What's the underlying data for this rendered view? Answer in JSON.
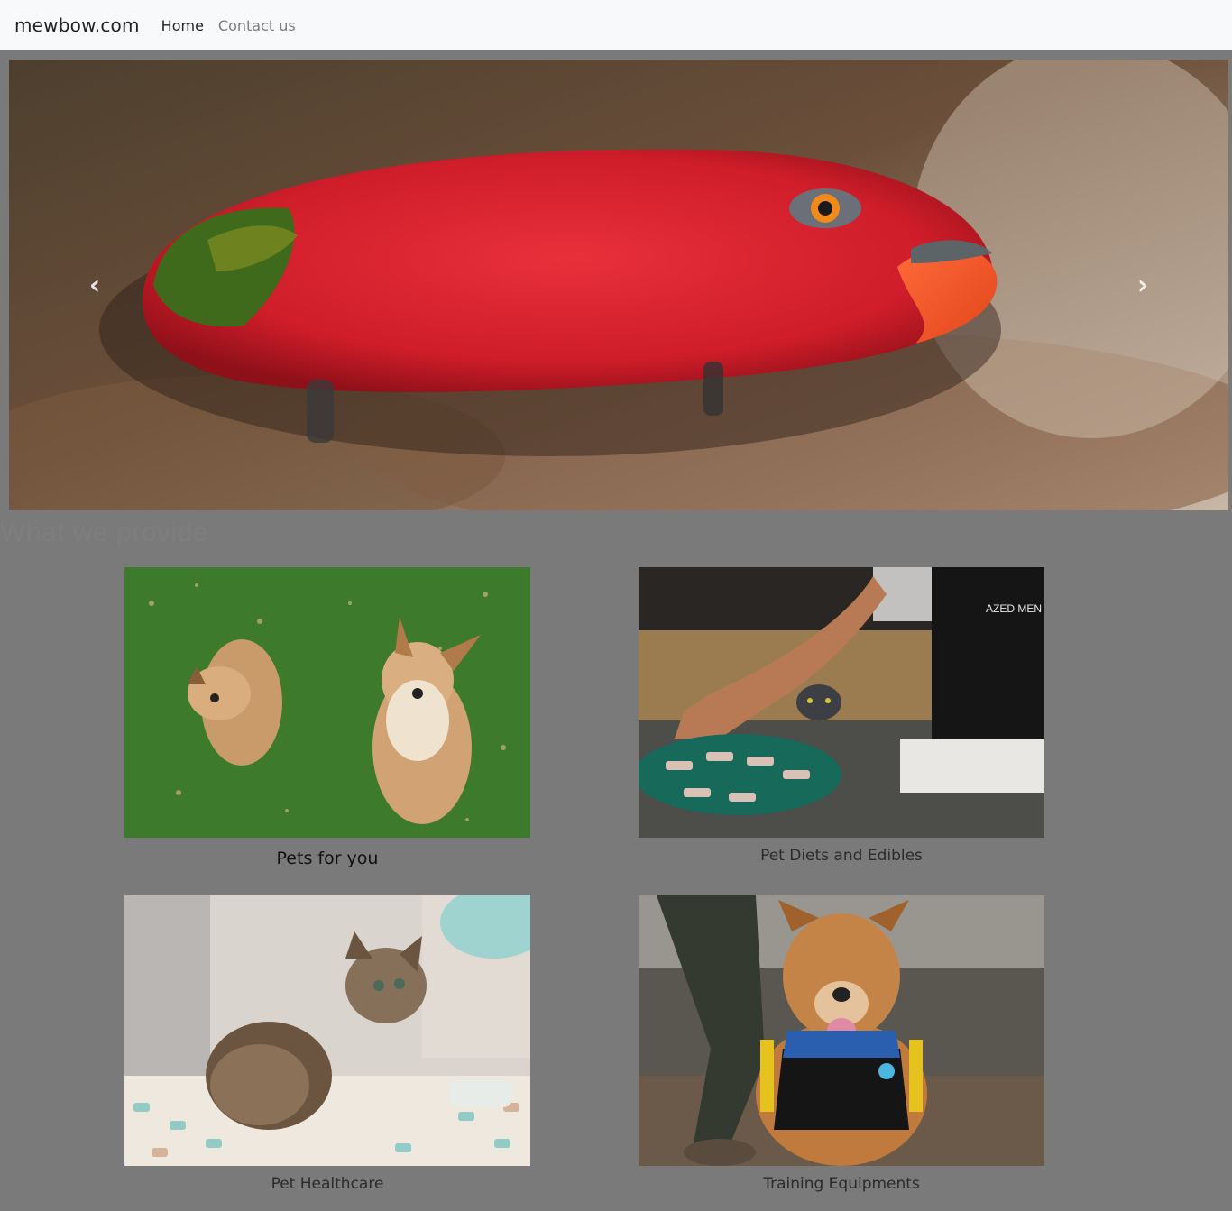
{
  "navbar": {
    "brand": "mewbow.com",
    "links": [
      {
        "label": "Home",
        "active": true
      },
      {
        "label": "Contact us",
        "active": false
      }
    ]
  },
  "carousel": {
    "prev_icon": "chevron-left-icon",
    "next_icon": "chevron-right-icon",
    "slide_subject": "red parrot"
  },
  "section": {
    "title": "What we provide"
  },
  "services": [
    {
      "caption": "Pets for you",
      "image_subject": "two dogs on grass"
    },
    {
      "caption": "Pet Diets and Edibles",
      "image_subject": "hand placing food with cat"
    },
    {
      "caption": "Pet Healthcare",
      "image_subject": "tabby kitten"
    },
    {
      "caption": "Training Equipments",
      "image_subject": "dog in harness"
    }
  ],
  "colors": {
    "page_background": "#7a7a7a",
    "navbar_background": "#f8f9fa",
    "parrot_red": "#d81f2e",
    "grass_green": "#3f7a2c"
  }
}
